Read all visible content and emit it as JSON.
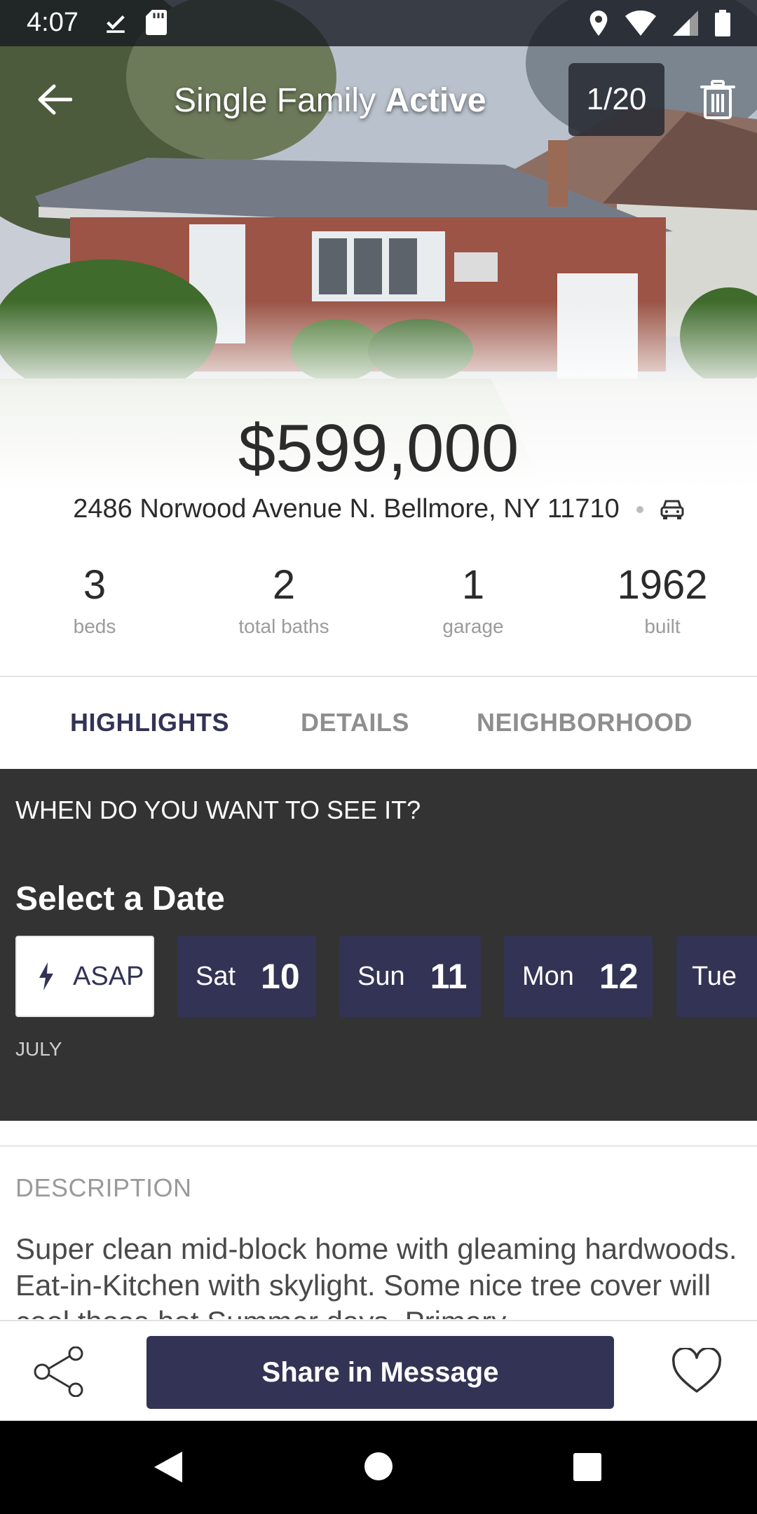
{
  "status_bar": {
    "time": "4:07",
    "icons": [
      "download-done-icon",
      "sd-card-icon",
      "location-icon",
      "wifi-icon",
      "cell-signal-icon",
      "battery-icon"
    ]
  },
  "header": {
    "title_prefix": "Single Family",
    "title_status": "Active",
    "photo_counter": "1/20"
  },
  "listing": {
    "price": "$599,000",
    "address": "2486 Norwood Avenue N. Bellmore, NY 11710"
  },
  "stats": [
    {
      "value": "3",
      "label": "beds"
    },
    {
      "value": "2",
      "label": "total baths"
    },
    {
      "value": "1",
      "label": "garage"
    },
    {
      "value": "1962",
      "label": "built"
    }
  ],
  "tabs": [
    {
      "label": "HIGHLIGHTS",
      "active": true
    },
    {
      "label": "DETAILS",
      "active": false
    },
    {
      "label": "NEIGHBORHOOD",
      "active": false
    }
  ],
  "scheduler": {
    "question": "WHEN DO YOU WANT TO SEE IT?",
    "heading": "Select a Date",
    "asap_label": "ASAP",
    "dates": [
      {
        "dow": "Sat",
        "day": "10"
      },
      {
        "dow": "Sun",
        "day": "11"
      },
      {
        "dow": "Mon",
        "day": "12"
      },
      {
        "dow": "Tue",
        "day": ""
      }
    ],
    "month": "JULY"
  },
  "description": {
    "title": "DESCRIPTION",
    "text": "Super clean mid-block home with gleaming hardwoods.  Eat-in-Kitchen with skylight. Some nice tree cover will cool those hot Summer days.  Primary"
  },
  "actions": {
    "share_message_label": "Share in Message"
  },
  "colors": {
    "primary": "#333356",
    "scheduler_bg": "#333333",
    "text_dark": "#2b2b2b",
    "text_muted": "#9b9b9b"
  }
}
